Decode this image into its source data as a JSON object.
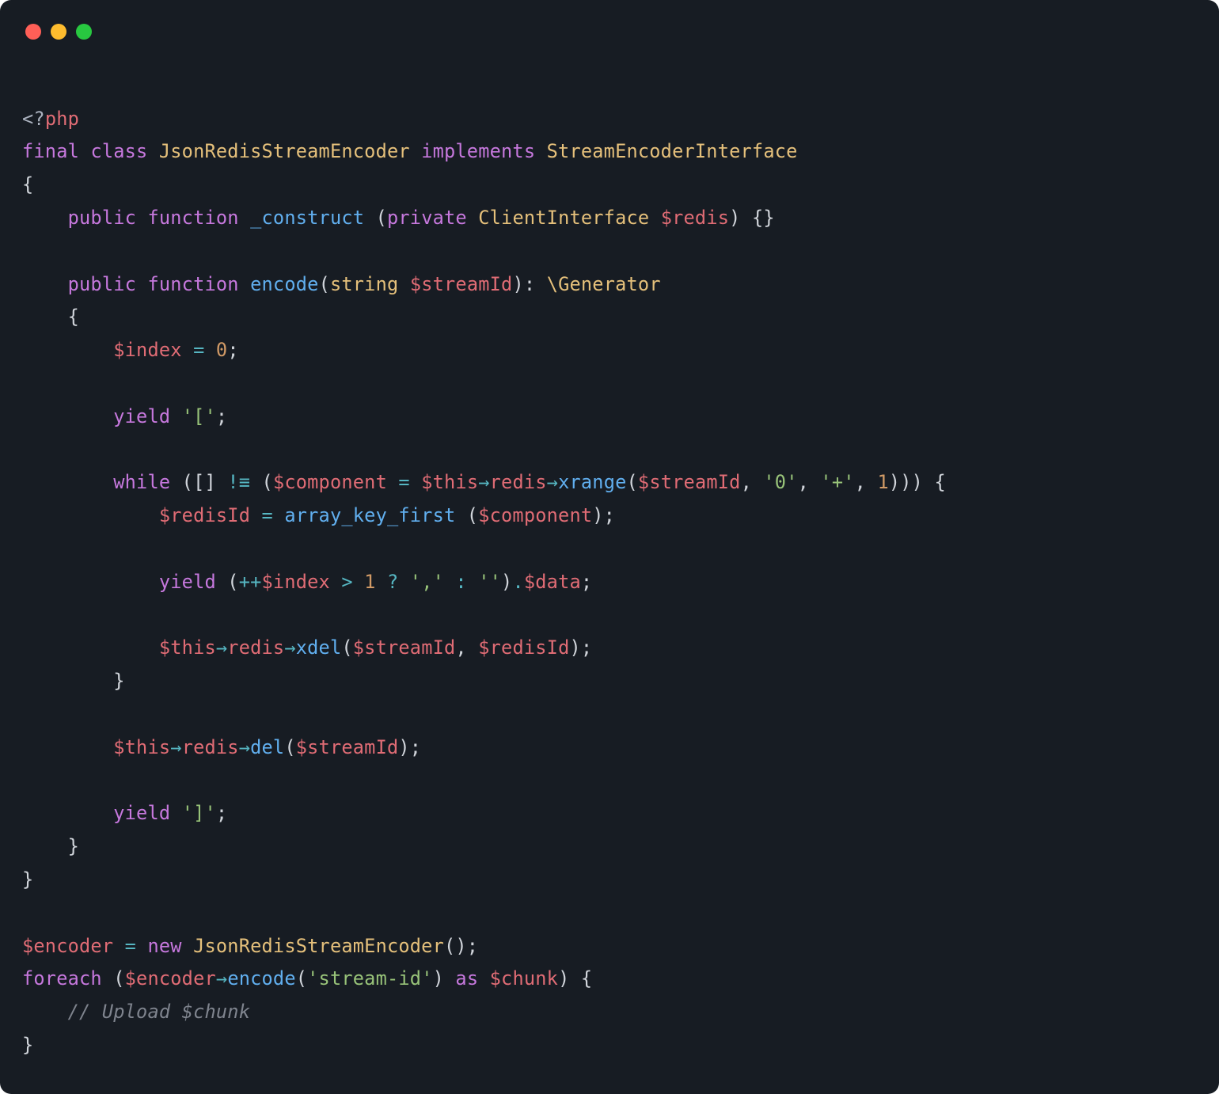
{
  "window": {
    "traffic": [
      "close",
      "minimize",
      "zoom"
    ]
  },
  "colors": {
    "background": "#171c23",
    "red_dot": "#ff5f57",
    "yellow_dot": "#febc2e",
    "green_dot": "#28c840",
    "keyword": "#c678dd",
    "function": "#61afef",
    "type": "#e5c07b",
    "variable": "#e06c75",
    "string": "#98c379",
    "number": "#d19a66",
    "operator": "#56b6c2",
    "comment": "#7f848e",
    "punct": "#d1d5db"
  },
  "code": {
    "language": "php",
    "tokens": [
      [
        {
          "c": "xml",
          "t": "<?"
        },
        {
          "c": "tag",
          "t": "php"
        }
      ],
      [
        {
          "c": "kw",
          "t": "final"
        },
        {
          "c": "p",
          "t": " "
        },
        {
          "c": "kw",
          "t": "class"
        },
        {
          "c": "p",
          "t": " "
        },
        {
          "c": "ty",
          "t": "JsonRedisStreamEncoder"
        },
        {
          "c": "p",
          "t": " "
        },
        {
          "c": "kw",
          "t": "implements"
        },
        {
          "c": "p",
          "t": " "
        },
        {
          "c": "ty",
          "t": "StreamEncoderInterface"
        }
      ],
      [
        {
          "c": "p",
          "t": "{"
        }
      ],
      [
        {
          "c": "p",
          "t": "    "
        },
        {
          "c": "kw",
          "t": "public"
        },
        {
          "c": "p",
          "t": " "
        },
        {
          "c": "kw",
          "t": "function"
        },
        {
          "c": "p",
          "t": " "
        },
        {
          "c": "fn",
          "t": "_construct"
        },
        {
          "c": "p",
          "t": " ("
        },
        {
          "c": "kw",
          "t": "private"
        },
        {
          "c": "p",
          "t": " "
        },
        {
          "c": "ty",
          "t": "ClientInterface"
        },
        {
          "c": "p",
          "t": " "
        },
        {
          "c": "va",
          "t": "$redis"
        },
        {
          "c": "p",
          "t": ") {}"
        }
      ],
      [
        {
          "c": "p",
          "t": ""
        }
      ],
      [
        {
          "c": "p",
          "t": "    "
        },
        {
          "c": "kw",
          "t": "public"
        },
        {
          "c": "p",
          "t": " "
        },
        {
          "c": "kw",
          "t": "function"
        },
        {
          "c": "p",
          "t": " "
        },
        {
          "c": "fn",
          "t": "encode"
        },
        {
          "c": "p",
          "t": "("
        },
        {
          "c": "ty",
          "t": "string"
        },
        {
          "c": "p",
          "t": " "
        },
        {
          "c": "va",
          "t": "$streamId"
        },
        {
          "c": "p",
          "t": "): "
        },
        {
          "c": "ty",
          "t": "\\Generator"
        }
      ],
      [
        {
          "c": "p",
          "t": "    {"
        }
      ],
      [
        {
          "c": "p",
          "t": "        "
        },
        {
          "c": "va",
          "t": "$index"
        },
        {
          "c": "p",
          "t": " "
        },
        {
          "c": "op",
          "t": "="
        },
        {
          "c": "p",
          "t": " "
        },
        {
          "c": "nu",
          "t": "0"
        },
        {
          "c": "p",
          "t": ";"
        }
      ],
      [
        {
          "c": "p",
          "t": ""
        }
      ],
      [
        {
          "c": "p",
          "t": "        "
        },
        {
          "c": "kw",
          "t": "yield"
        },
        {
          "c": "p",
          "t": " "
        },
        {
          "c": "st",
          "t": "'['"
        },
        {
          "c": "p",
          "t": ";"
        }
      ],
      [
        {
          "c": "p",
          "t": ""
        }
      ],
      [
        {
          "c": "p",
          "t": "        "
        },
        {
          "c": "kw",
          "t": "while"
        },
        {
          "c": "p",
          "t": " ([] "
        },
        {
          "c": "op",
          "t": "!≡"
        },
        {
          "c": "p",
          "t": " ("
        },
        {
          "c": "va",
          "t": "$component"
        },
        {
          "c": "p",
          "t": " "
        },
        {
          "c": "op",
          "t": "="
        },
        {
          "c": "p",
          "t": " "
        },
        {
          "c": "va",
          "t": "$this"
        },
        {
          "c": "op",
          "t": "→"
        },
        {
          "c": "va",
          "t": "redis"
        },
        {
          "c": "op",
          "t": "→"
        },
        {
          "c": "fn",
          "t": "xrange"
        },
        {
          "c": "p",
          "t": "("
        },
        {
          "c": "va",
          "t": "$streamId"
        },
        {
          "c": "p",
          "t": ", "
        },
        {
          "c": "st",
          "t": "'0'"
        },
        {
          "c": "p",
          "t": ", "
        },
        {
          "c": "st",
          "t": "'+'"
        },
        {
          "c": "p",
          "t": ", "
        },
        {
          "c": "nu",
          "t": "1"
        },
        {
          "c": "p",
          "t": "))) {"
        }
      ],
      [
        {
          "c": "p",
          "t": "            "
        },
        {
          "c": "va",
          "t": "$redisId"
        },
        {
          "c": "p",
          "t": " "
        },
        {
          "c": "op",
          "t": "="
        },
        {
          "c": "p",
          "t": " "
        },
        {
          "c": "fn",
          "t": "array_key_first"
        },
        {
          "c": "p",
          "t": " ("
        },
        {
          "c": "va",
          "t": "$component"
        },
        {
          "c": "p",
          "t": ");"
        }
      ],
      [
        {
          "c": "p",
          "t": ""
        }
      ],
      [
        {
          "c": "p",
          "t": "            "
        },
        {
          "c": "kw",
          "t": "yield"
        },
        {
          "c": "p",
          "t": " ("
        },
        {
          "c": "op",
          "t": "++"
        },
        {
          "c": "va",
          "t": "$index"
        },
        {
          "c": "p",
          "t": " "
        },
        {
          "c": "op",
          "t": ">"
        },
        {
          "c": "p",
          "t": " "
        },
        {
          "c": "nu",
          "t": "1"
        },
        {
          "c": "p",
          "t": " "
        },
        {
          "c": "op",
          "t": "?"
        },
        {
          "c": "p",
          "t": " "
        },
        {
          "c": "st",
          "t": "','"
        },
        {
          "c": "p",
          "t": " "
        },
        {
          "c": "op",
          "t": ":"
        },
        {
          "c": "p",
          "t": " "
        },
        {
          "c": "st",
          "t": "''"
        },
        {
          "c": "p",
          "t": ")"
        },
        {
          "c": "op",
          "t": "."
        },
        {
          "c": "va",
          "t": "$data"
        },
        {
          "c": "p",
          "t": ";"
        }
      ],
      [
        {
          "c": "p",
          "t": ""
        }
      ],
      [
        {
          "c": "p",
          "t": "            "
        },
        {
          "c": "va",
          "t": "$this"
        },
        {
          "c": "op",
          "t": "→"
        },
        {
          "c": "va",
          "t": "redis"
        },
        {
          "c": "op",
          "t": "→"
        },
        {
          "c": "fn",
          "t": "xdel"
        },
        {
          "c": "p",
          "t": "("
        },
        {
          "c": "va",
          "t": "$streamId"
        },
        {
          "c": "p",
          "t": ", "
        },
        {
          "c": "va",
          "t": "$redisId"
        },
        {
          "c": "p",
          "t": ");"
        }
      ],
      [
        {
          "c": "p",
          "t": "        }"
        }
      ],
      [
        {
          "c": "p",
          "t": ""
        }
      ],
      [
        {
          "c": "p",
          "t": "        "
        },
        {
          "c": "va",
          "t": "$this"
        },
        {
          "c": "op",
          "t": "→"
        },
        {
          "c": "va",
          "t": "redis"
        },
        {
          "c": "op",
          "t": "→"
        },
        {
          "c": "fn",
          "t": "del"
        },
        {
          "c": "p",
          "t": "("
        },
        {
          "c": "va",
          "t": "$streamId"
        },
        {
          "c": "p",
          "t": ");"
        }
      ],
      [
        {
          "c": "p",
          "t": ""
        }
      ],
      [
        {
          "c": "p",
          "t": "        "
        },
        {
          "c": "kw",
          "t": "yield"
        },
        {
          "c": "p",
          "t": " "
        },
        {
          "c": "st",
          "t": "']'"
        },
        {
          "c": "p",
          "t": ";"
        }
      ],
      [
        {
          "c": "p",
          "t": "    }"
        }
      ],
      [
        {
          "c": "p",
          "t": "}"
        }
      ],
      [
        {
          "c": "p",
          "t": ""
        }
      ],
      [
        {
          "c": "va",
          "t": "$encoder"
        },
        {
          "c": "p",
          "t": " "
        },
        {
          "c": "op",
          "t": "="
        },
        {
          "c": "p",
          "t": " "
        },
        {
          "c": "kw",
          "t": "new"
        },
        {
          "c": "p",
          "t": " "
        },
        {
          "c": "ty",
          "t": "JsonRedisStreamEncoder"
        },
        {
          "c": "p",
          "t": "();"
        }
      ],
      [
        {
          "c": "kw",
          "t": "foreach"
        },
        {
          "c": "p",
          "t": " ("
        },
        {
          "c": "va",
          "t": "$encoder"
        },
        {
          "c": "op",
          "t": "→"
        },
        {
          "c": "fn",
          "t": "encode"
        },
        {
          "c": "p",
          "t": "("
        },
        {
          "c": "st",
          "t": "'stream-id'"
        },
        {
          "c": "p",
          "t": ") "
        },
        {
          "c": "kw",
          "t": "as"
        },
        {
          "c": "p",
          "t": " "
        },
        {
          "c": "va",
          "t": "$chunk"
        },
        {
          "c": "p",
          "t": ") {"
        }
      ],
      [
        {
          "c": "p",
          "t": "    "
        },
        {
          "c": "cm",
          "t": "// Upload $chunk"
        }
      ],
      [
        {
          "c": "p",
          "t": "}"
        }
      ]
    ]
  }
}
